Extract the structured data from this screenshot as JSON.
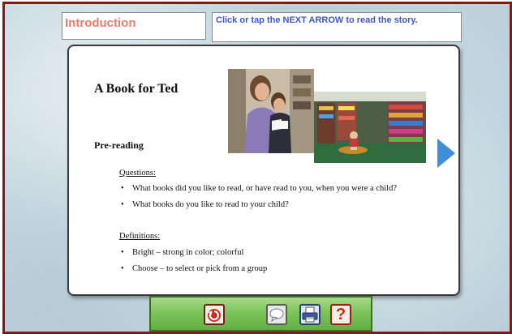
{
  "header": {
    "title": "Introduction",
    "instruction": "Click or tap the NEXT ARROW to read the story."
  },
  "lesson": {
    "book_title": "A Book for Ted",
    "section_title": "Pre-reading",
    "questions_label": "Questions:",
    "questions": [
      "What books did you like to read, or have read to you, when you were a child?",
      "What books do you like to read to your child?"
    ],
    "definitions_label": "Definitions:",
    "definitions": [
      "Bright – strong in color; colorful",
      "Choose – to select or pick from a group"
    ]
  },
  "navigation": {
    "next_arrow_icon": "next-arrow-icon"
  },
  "toolbar": {
    "icons": [
      "back-icon",
      "chat-icon",
      "print-icon",
      "help-icon"
    ],
    "help_symbol": "?"
  },
  "colors": {
    "frame_border": "#8c1414",
    "title_text": "#f07a6a",
    "instruction_text": "#3f56c9",
    "next_arrow": "#3f8edb",
    "toolbar_green": "#7dc55a"
  }
}
